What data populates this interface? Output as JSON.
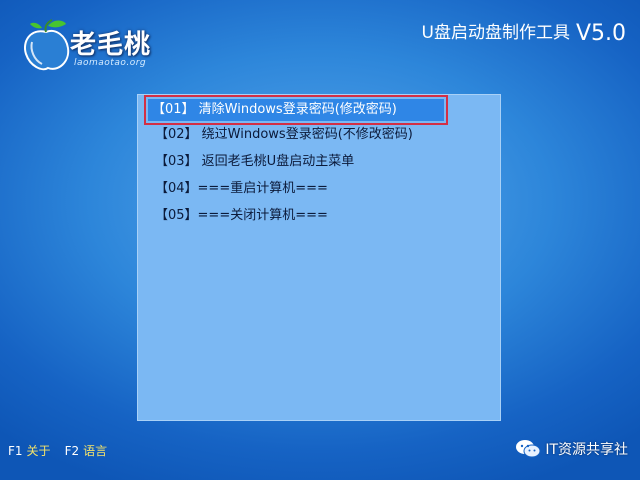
{
  "logo": {
    "name": "老毛桃",
    "url": "laomaotao.org",
    "peach_color": "#3f9ee6",
    "leaf_color": "#48c42f"
  },
  "app_title": {
    "name": "U盘启动盘制作工具",
    "version": "V5.0"
  },
  "menu": {
    "items": [
      {
        "label": "【01】 清除Windows登录密码(修改密码)",
        "selected": true
      },
      {
        "label": "【02】 绕过Windows登录密码(不修改密码)",
        "selected": false
      },
      {
        "label": "【03】 返回老毛桃U盘启动主菜单",
        "selected": false
      },
      {
        "label": "【04】===重启计算机===",
        "selected": false
      },
      {
        "label": "【05】===关闭计算机===",
        "selected": false
      }
    ],
    "highlight_color": "#2f86e6",
    "annotation_color": "#d32f45"
  },
  "footer": {
    "f1_key": "F1",
    "f1_label": "关于",
    "f2_key": "F2",
    "f2_label": "语言"
  },
  "watermark": {
    "icon": "wechat-icon",
    "text": "IT资源共享社"
  }
}
